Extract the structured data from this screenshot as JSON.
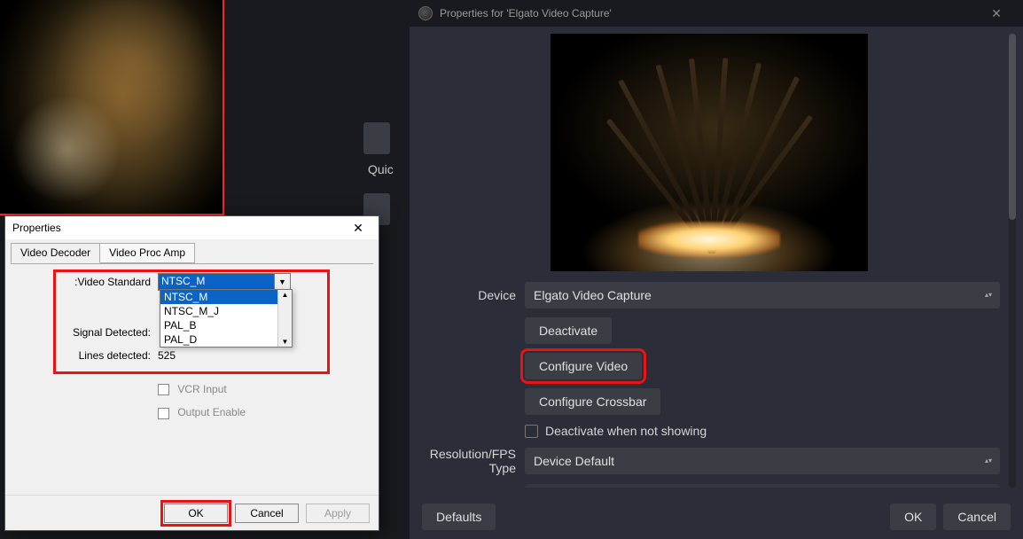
{
  "background": {
    "quick_label": "Quic"
  },
  "obs": {
    "title": "Properties for 'Elgato Video Capture'",
    "device_label": "Device",
    "device_value": "Elgato Video Capture",
    "deactivate_btn": "Deactivate",
    "configure_video_btn": "Configure Video",
    "configure_crossbar_btn": "Configure Crossbar",
    "deactivate_not_showing": "Deactivate when not showing",
    "res_label": "Resolution/FPS Type",
    "res_value": "Device Default",
    "defaults_btn": "Defaults",
    "ok_btn": "OK",
    "cancel_btn": "Cancel"
  },
  "win": {
    "title": "Properties",
    "tab_decoder": "Video Decoder",
    "tab_procamp": "Video Proc Amp",
    "video_standard_label": ":Video Standard",
    "video_standard_value": "NTSC_M",
    "options": [
      "NTSC_M",
      "NTSC_M_J",
      "PAL_B",
      "PAL_D"
    ],
    "selected_option_index": 0,
    "signal_detected_label": "Signal Detected:",
    "signal_detected_value": "",
    "lines_detected_label": "Lines detected:",
    "lines_detected_value": "525",
    "vcr_input_label": "VCR Input",
    "output_enable_label": "Output Enable",
    "ok_btn": "OK",
    "cancel_btn": "Cancel",
    "apply_btn": "Apply"
  }
}
